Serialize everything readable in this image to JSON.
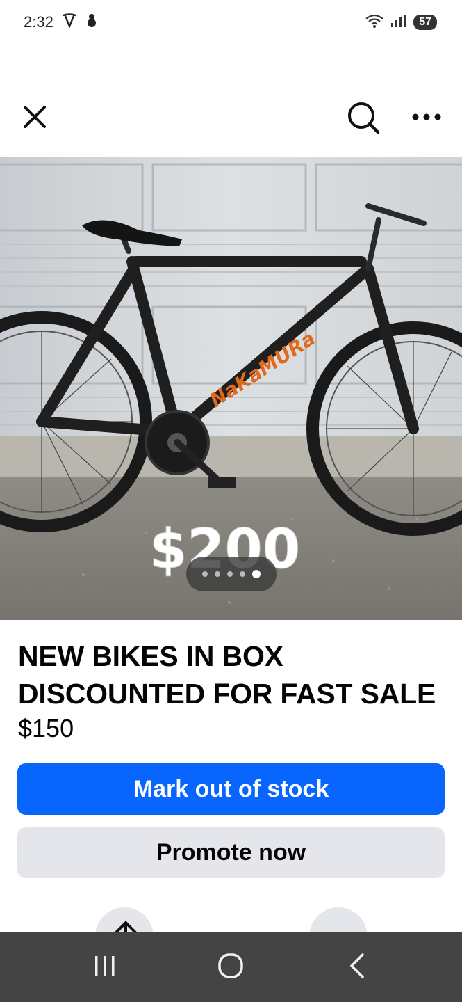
{
  "status": {
    "time": "2:32",
    "battery": "57",
    "icons": [
      "tesla-icon",
      "snowman-icon",
      "wifi-icon",
      "signal-icon",
      "battery-icon"
    ]
  },
  "header": {
    "close_icon": "close-icon",
    "search_icon": "search-icon",
    "more_icon": "more-icon"
  },
  "photo": {
    "subject": "black and orange mountain bike",
    "brand_text": "NaKaMURa",
    "overlay_price": "$200",
    "pager": {
      "total": 5,
      "active": 5
    }
  },
  "listing": {
    "title_line1": "NEW BIKES IN BOX",
    "title_line2": "DISCOUNTED FOR FAST SALE",
    "price": "$150"
  },
  "actions": {
    "mark_out_of_stock": "Mark out of stock",
    "promote_now": "Promote now"
  },
  "colors": {
    "primary": "#0866ff",
    "secondary": "#e4e6eb",
    "nav_bar": "#444444"
  },
  "nav": {
    "icons": [
      "recents-icon",
      "home-icon",
      "back-icon"
    ]
  }
}
